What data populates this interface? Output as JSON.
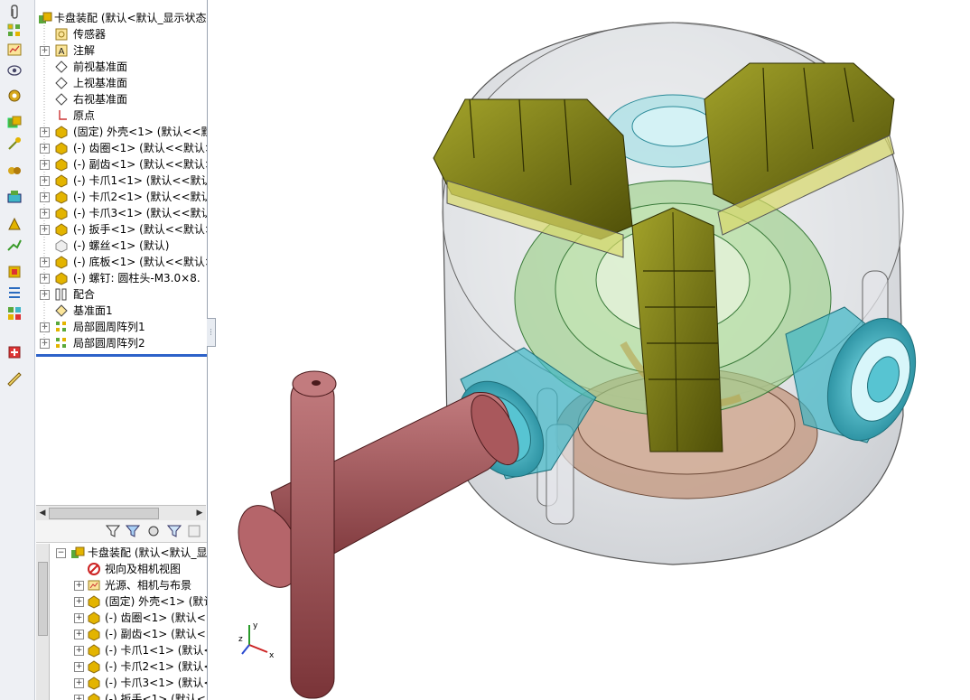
{
  "top_tree": {
    "root": "卡盘装配 (默认<默认_显示状态",
    "items": [
      "传感器",
      "注解",
      "前视基准面",
      "上视基准面",
      "右视基准面",
      "原点",
      "(固定) 外壳<1> (默认<<默认",
      "(-) 齿圈<1> (默认<<默认>",
      "(-) 副齿<1> (默认<<默认>",
      "(-) 卡爪1<1> (默认<<默认>",
      "(-) 卡爪2<1> (默认<<默认>",
      "(-) 卡爪3<1> (默认<<默认>",
      "(-) 扳手<1> (默认<<默认>",
      "(-) 螺丝<1> (默认)",
      "(-) 底板<1> (默认<<默认>",
      "(-) 螺钉: 圆柱头-M3.0×8.",
      "配合",
      "基准面1",
      "局部圆周阵列1",
      "局部圆周阵列2"
    ]
  },
  "bottom_tree": {
    "root": "卡盘装配 (默认<默认_显",
    "items": [
      "视向及相机视图",
      "光源、相机与布景",
      "(固定) 外壳<1> (默认<",
      "(-) 齿圈<1> (默认<<",
      "(-) 副齿<1> (默认<<",
      "(-) 卡爪1<1> (默认<",
      "(-) 卡爪2<1> (默认<",
      "(-) 卡爪3<1> (默认<",
      "(-) 扳手<1> (默认<"
    ]
  },
  "triad": {
    "x": "x",
    "y": "y",
    "z": "z"
  },
  "toolbar_icons": [
    "paperclip-icon",
    "pattern-icon",
    "chart-icon",
    "view-icon",
    "gear-icon",
    "assembly-icon",
    "move-icon",
    "mate-icon",
    "feature-icon",
    "smart-icon",
    "move-component-icon",
    "rotate-icon",
    "exploded-view-icon",
    "bom-icon",
    "interference-icon",
    "measure-icon"
  ],
  "filter_icons": [
    "filter-icon",
    "filter-parts-icon",
    "filter-features-icon",
    "filter-mates-icon",
    "filter-hidden-icon"
  ],
  "colors": {
    "jaw": "#6b6b12",
    "gear_teal": "#3fb6c6",
    "wrench": "#9a4b4f",
    "housing": "#d9dce0",
    "ring_green": "#9ccf8a",
    "selection_blue": "#2d62c9"
  }
}
